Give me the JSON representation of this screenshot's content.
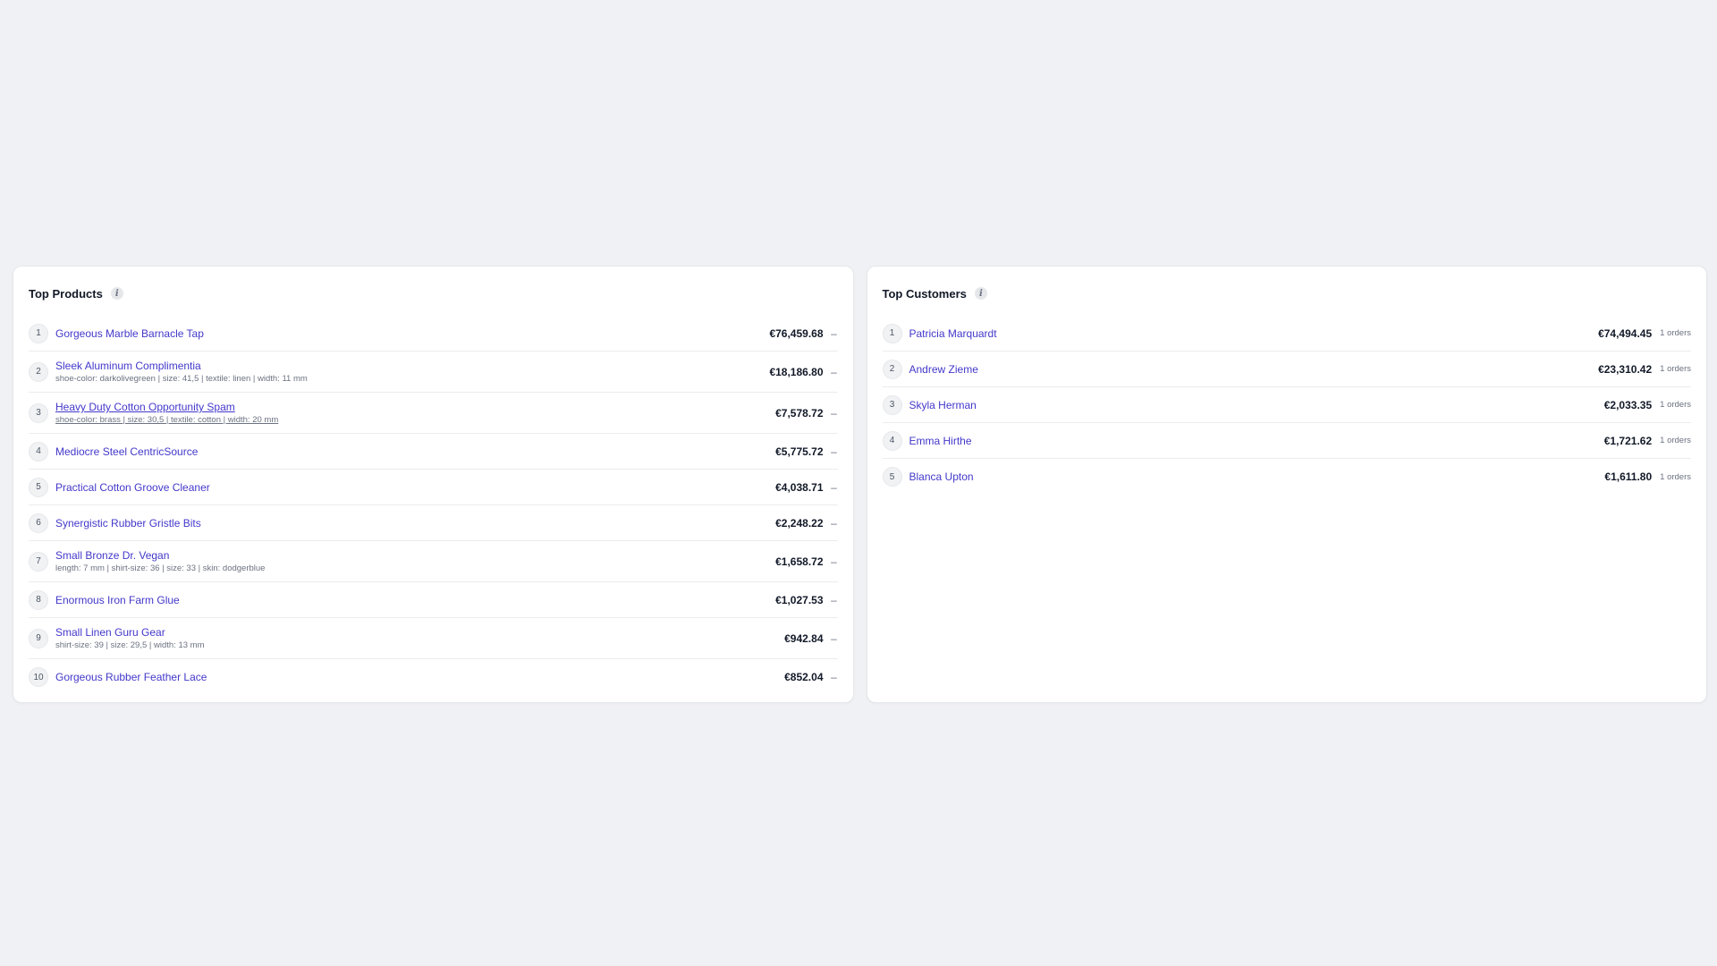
{
  "products": {
    "title": "Top Products",
    "info_icon": "info-icon",
    "items": [
      {
        "rank": "1",
        "name": "Gorgeous Marble Barnacle Tap",
        "sub": "",
        "amount": "€76,459.68",
        "trend": "–"
      },
      {
        "rank": "2",
        "name": "Sleek Aluminum Complimentia",
        "sub": "shoe-color: darkolivegreen | size: 41,5 | textile: linen | width: 11 mm",
        "amount": "€18,186.80",
        "trend": "–"
      },
      {
        "rank": "3",
        "name": "Heavy Duty Cotton Opportunity Spam",
        "sub": "shoe-color: brass | size: 30,5 | textile: cotton | width: 20 mm",
        "amount": "€7,578.72",
        "trend": "–",
        "hovered": true
      },
      {
        "rank": "4",
        "name": "Mediocre Steel CentricSource",
        "sub": "",
        "amount": "€5,775.72",
        "trend": "–"
      },
      {
        "rank": "5",
        "name": "Practical Cotton Groove Cleaner",
        "sub": "",
        "amount": "€4,038.71",
        "trend": "–"
      },
      {
        "rank": "6",
        "name": "Synergistic Rubber Gristle Bits",
        "sub": "",
        "amount": "€2,248.22",
        "trend": "–"
      },
      {
        "rank": "7",
        "name": "Small Bronze Dr. Vegan",
        "sub": "length: 7 mm | shirt-size: 36 | size: 33 | skin: dodgerblue",
        "amount": "€1,658.72",
        "trend": "–"
      },
      {
        "rank": "8",
        "name": "Enormous Iron Farm Glue",
        "sub": "",
        "amount": "€1,027.53",
        "trend": "–"
      },
      {
        "rank": "9",
        "name": "Small Linen Guru Gear",
        "sub": "shirt-size: 39 | size: 29,5 | width: 13 mm",
        "amount": "€942.84",
        "trend": "–"
      },
      {
        "rank": "10",
        "name": "Gorgeous Rubber Feather Lace",
        "sub": "",
        "amount": "€852.04",
        "trend": "–"
      }
    ]
  },
  "customers": {
    "title": "Top Customers",
    "info_icon": "info-icon",
    "items": [
      {
        "rank": "1",
        "name": "Patricia Marquardt",
        "amount": "€74,494.45",
        "orders": "1 orders"
      },
      {
        "rank": "2",
        "name": "Andrew Zieme",
        "amount": "€23,310.42",
        "orders": "1 orders"
      },
      {
        "rank": "3",
        "name": "Skyla Herman",
        "amount": "€2,033.35",
        "orders": "1 orders"
      },
      {
        "rank": "4",
        "name": "Emma Hirthe",
        "amount": "€1,721.62",
        "orders": "1 orders"
      },
      {
        "rank": "5",
        "name": "Blanca Upton",
        "amount": "€1,611.80",
        "orders": "1 orders"
      }
    ]
  },
  "colors": {
    "link": "#4338ca",
    "background": "#f0f1f4",
    "card": "#ffffff"
  }
}
